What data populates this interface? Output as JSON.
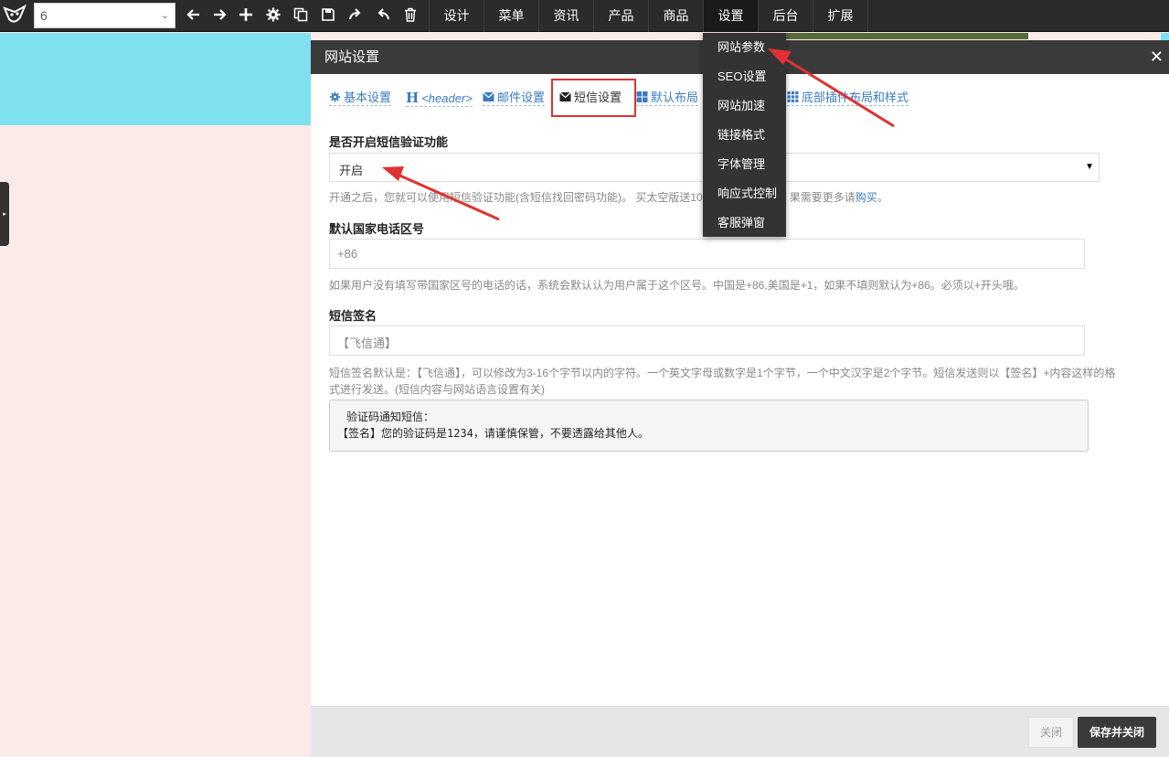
{
  "toolbar": {
    "page_select_value": "6",
    "menu": [
      "设计",
      "菜单",
      "资讯",
      "产品",
      "商品",
      "设置",
      "后台",
      "扩展"
    ],
    "active_menu": "设置"
  },
  "dropdown": {
    "items": [
      "网站参数",
      "SEO设置",
      "网站加速",
      "链接格式",
      "字体管理",
      "响应式控制",
      "客服弹窗"
    ]
  },
  "dialog": {
    "title": "网站设置",
    "close_glyph": "✕",
    "tabs": [
      "基本设置",
      "<header>",
      "邮件设置",
      "短信设置",
      "默认布局",
      "底部插件布局和样式"
    ],
    "active_tab": "短信设置",
    "sms_enable": {
      "label": "是否开启短信验证功能",
      "value": "开启",
      "help_prefix": "开通之后，您就可以使用短信验证功能(含短信找回密码功能)。 买太空版送10",
      "help_suffix": "果需要更多请",
      "help_link": "购买",
      "help_end": "。"
    },
    "country_code": {
      "label": "默认国家电话区号",
      "placeholder": "+86",
      "help": "如果用户没有填写带国家区号的电话的话，系统会默认认为用户属于这个区号。中国是+86,美国是+1，如果不填则默认为+86。必须以+开头哦。"
    },
    "signature": {
      "label": "短信签名",
      "placeholder": "【飞信通】",
      "help_line1": "短信签名默认是：【飞信通】，可以修改为3-16个字节以内的字符。一个英文字母或数字是1个字节，一个中文汉字是2个字节。短信发送则以【签名】+内容这样的格",
      "help_line2": "式进行发送。(短信内容与网站语言设置有关)"
    },
    "preview": {
      "line1": "验证码通知短信：",
      "line2": "【签名】您的验证码是1234，请谨慎保管，不要透露给其他人。"
    },
    "footer": {
      "close_label": "关闭",
      "save_label": "保存并关闭"
    }
  },
  "colors": {
    "topbar": "#2b2b2b",
    "accent_link": "#3a7bbf",
    "annotation_red": "#e03232",
    "bg_cyan": "#7fe1f0",
    "bg_pink": "#fbebe8"
  }
}
